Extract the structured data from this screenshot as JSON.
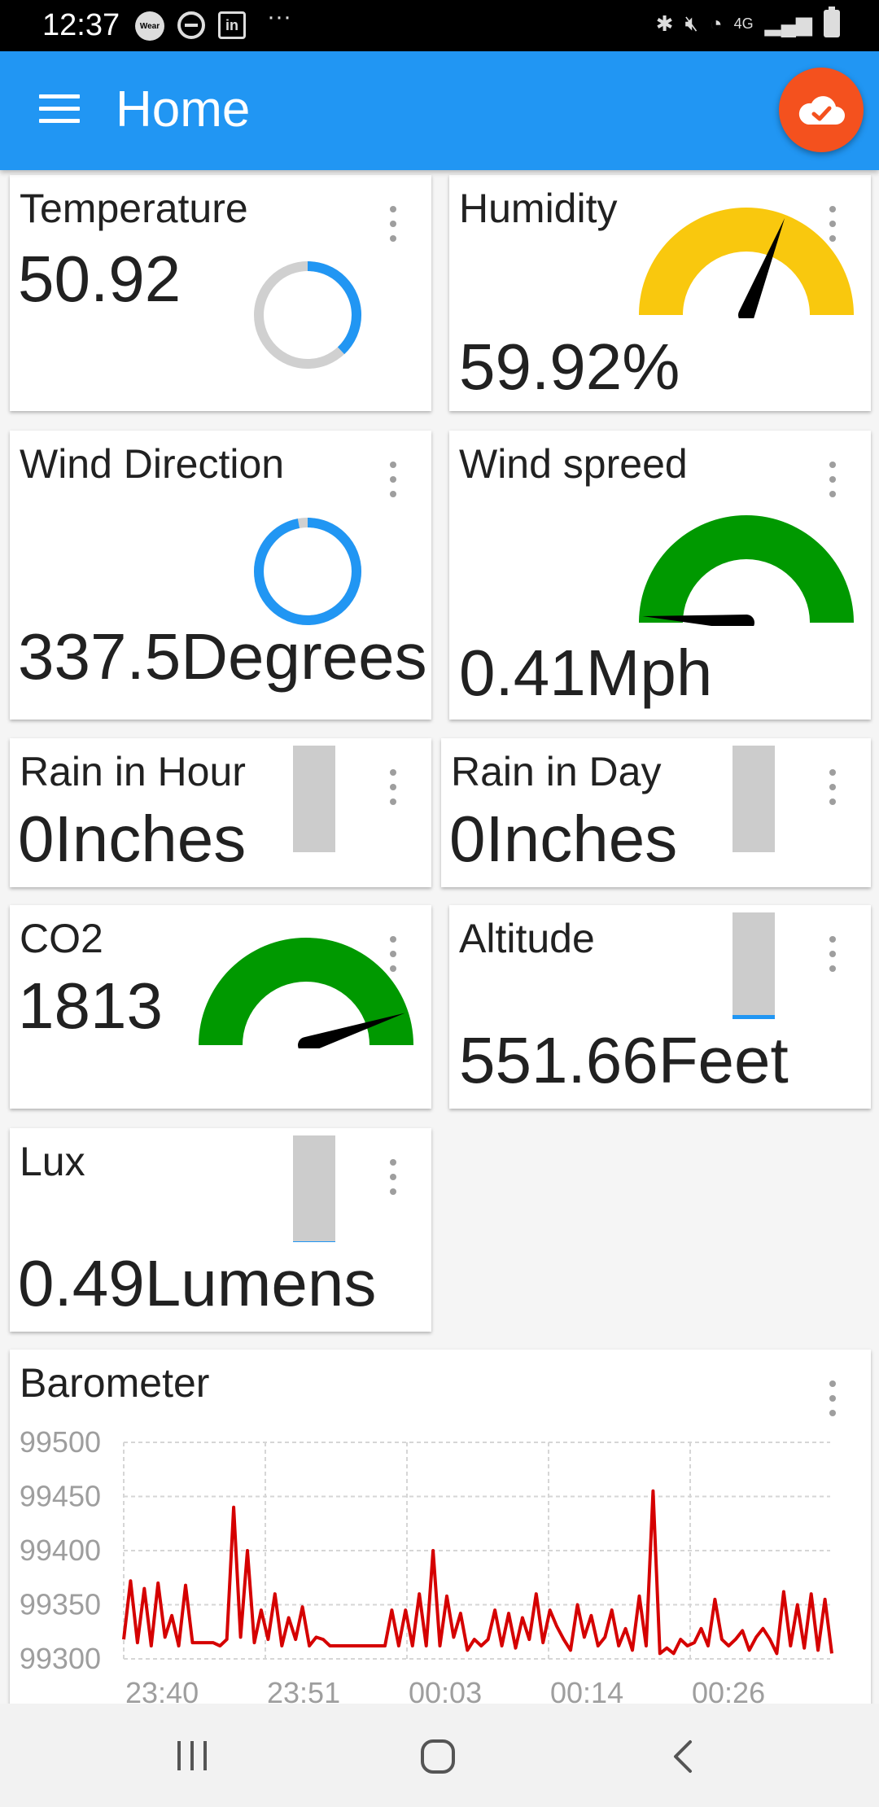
{
  "status_bar": {
    "time": "12:37",
    "network": "4G",
    "icons": [
      "wear-os-icon",
      "do-not-disturb-icon",
      "linkedin-icon",
      "more-dots-icon",
      "bluetooth-icon",
      "mute-icon",
      "wifi-icon",
      "signal-icon",
      "battery-icon"
    ]
  },
  "app_bar": {
    "title": "Home",
    "menu_icon": "hamburger-menu-icon",
    "action_icon": "cloud-check-icon",
    "color": "#2196f3",
    "action_color": "#f4511e"
  },
  "widgets": {
    "temperature": {
      "title": "Temperature",
      "value": "50.92",
      "ring_fraction": 0.38
    },
    "humidity": {
      "title": "Humidity",
      "value": "59.92%",
      "gauge_fraction": 0.62,
      "gauge_color": "#f9c80e"
    },
    "wind_direction": {
      "title": "Wind Direction",
      "value": "337.5Degrees",
      "ring_fraction": 0.97
    },
    "wind_speed": {
      "title": "Wind spreed",
      "value": "0.41Mph",
      "gauge_fraction": 0.02,
      "gauge_color": "#009900"
    },
    "rain_hour": {
      "title": "Rain in Hour",
      "value": "0Inches",
      "bar_fraction": 0
    },
    "rain_day": {
      "title": "Rain in Day",
      "value": "0Inches",
      "bar_fraction": 0
    },
    "co2": {
      "title": "CO2",
      "value": "1813",
      "gauge_fraction": 0.9,
      "gauge_color": "#009900"
    },
    "altitude": {
      "title": "Altitude",
      "value": "551.66Feet",
      "bar_fraction": 0.04
    },
    "lux": {
      "title": "Lux",
      "value": "0.49Lumens",
      "bar_fraction": 0.01
    }
  },
  "barometer": {
    "title": "Barometer"
  },
  "chart_data": {
    "type": "line",
    "title": "Barometer",
    "xlabel": "",
    "ylabel": "",
    "x_tick_labels": [
      "23:40",
      "23:51",
      "00:03",
      "00:14",
      "00:26"
    ],
    "y_tick_labels": [
      "99500",
      "99450",
      "99400",
      "99350",
      "99300"
    ],
    "y_ticks": [
      99500,
      99450,
      99400,
      99350,
      99300
    ],
    "ylim": [
      99300,
      99500
    ],
    "grid": true,
    "line_color": "#d50000",
    "series": [
      {
        "values": [
          99318,
          99372,
          99315,
          99365,
          99312,
          99370,
          99320,
          99340,
          99312,
          99368,
          99315,
          99315,
          99315,
          99315,
          99312,
          99318,
          99440,
          99320,
          99400,
          99315,
          99345,
          99318,
          99360,
          99312,
          99338,
          99318,
          99348,
          99312,
          99320,
          99318,
          99312,
          99312,
          99312,
          99312,
          99312,
          99312,
          99312,
          99312,
          99312,
          99345,
          99312,
          99345,
          99312,
          99360,
          99312,
          99400,
          99312,
          99358,
          99320,
          99342,
          99308,
          99318,
          99312,
          99318,
          99345,
          99312,
          99342,
          99310,
          99338,
          99318,
          99360,
          99315,
          99345,
          99330,
          99318,
          99308,
          99350,
          99320,
          99340,
          99312,
          99320,
          99345,
          99312,
          99328,
          99308,
          99358,
          99312,
          99455,
          99305,
          99310,
          99305,
          99318,
          99312,
          99315,
          99328,
          99312,
          99355,
          99318,
          99312,
          99318,
          99326,
          99308,
          99320,
          99328,
          99318,
          99305,
          99362,
          99312,
          99350,
          99310,
          99360,
          99308,
          99355,
          99305
        ]
      }
    ]
  },
  "nav_bar": {
    "buttons": [
      "recent-apps-icon",
      "home-icon",
      "back-icon"
    ]
  }
}
